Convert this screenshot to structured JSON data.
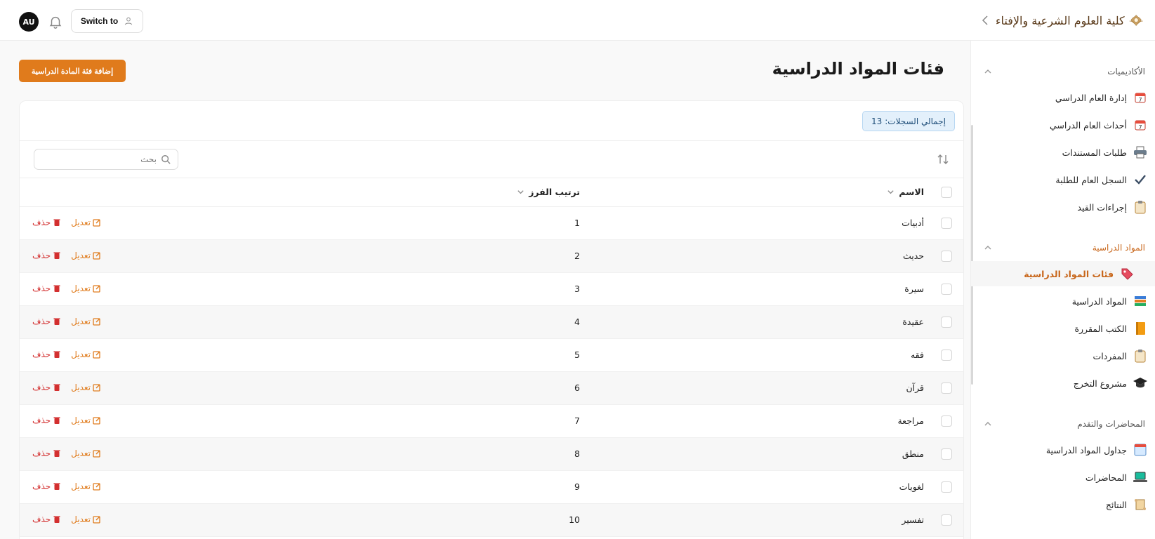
{
  "header": {
    "avatar_initials": "AU",
    "switch_label": "Switch to",
    "logo_text": "كلية العلوم الشرعية والإفتاء"
  },
  "sidebar": {
    "sections": [
      {
        "title": "الأكاديميات",
        "items": [
          {
            "label": "إدارة العام الدراسي",
            "icon": "calendar-icon"
          },
          {
            "label": "أحداث العام الدراسي",
            "icon": "calendar-icon"
          },
          {
            "label": "طلبات المستندات",
            "icon": "printer-icon"
          },
          {
            "label": "السجل العام للطلبة",
            "icon": "checkmark-icon"
          },
          {
            "label": "إجراءات القيد",
            "icon": "clipboard-icon"
          }
        ]
      },
      {
        "title": "المواد الدراسية",
        "items": [
          {
            "label": "فئات المواد الدراسية",
            "icon": "tag-icon"
          },
          {
            "label": "المواد الدراسية",
            "icon": "books-icon"
          },
          {
            "label": "الكتب المقررة",
            "icon": "book-icon"
          },
          {
            "label": "المفردات",
            "icon": "clipboard-icon"
          },
          {
            "label": "مشروع التخرج",
            "icon": "graduation-cap-icon"
          }
        ]
      },
      {
        "title": "المحاضرات والتقدم",
        "items": [
          {
            "label": "جداول المواد الدراسية",
            "icon": "schedule-icon"
          },
          {
            "label": "المحاضرات",
            "icon": "laptop-icon"
          },
          {
            "label": "النتائج",
            "icon": "scroll-icon"
          }
        ]
      }
    ]
  },
  "main": {
    "title": "فئات المواد الدراسية",
    "add_button": "إضافة فئة المادة الدراسية",
    "total_label": "إجمالي السجلات:",
    "total_count": "13",
    "search_placeholder": "بحث",
    "columns": {
      "name": "الاسم",
      "sort_order": "ترتيب الفرز"
    },
    "edit_label": "تعديل",
    "delete_label": "حذف",
    "rows": [
      {
        "name": "أدبيات",
        "order": "1"
      },
      {
        "name": "حديث",
        "order": "2"
      },
      {
        "name": "سيرة",
        "order": "3"
      },
      {
        "name": "عقيدة",
        "order": "4"
      },
      {
        "name": "فقه",
        "order": "5"
      },
      {
        "name": "قرآن",
        "order": "6"
      },
      {
        "name": "مراجعة",
        "order": "7"
      },
      {
        "name": "منطق",
        "order": "8"
      },
      {
        "name": "لغويات",
        "order": "9"
      },
      {
        "name": "تفسير",
        "order": "10"
      }
    ]
  },
  "colors": {
    "accent": "#e07b1c",
    "danger": "#d32f2f",
    "badge_bg": "#e3f0fb"
  }
}
